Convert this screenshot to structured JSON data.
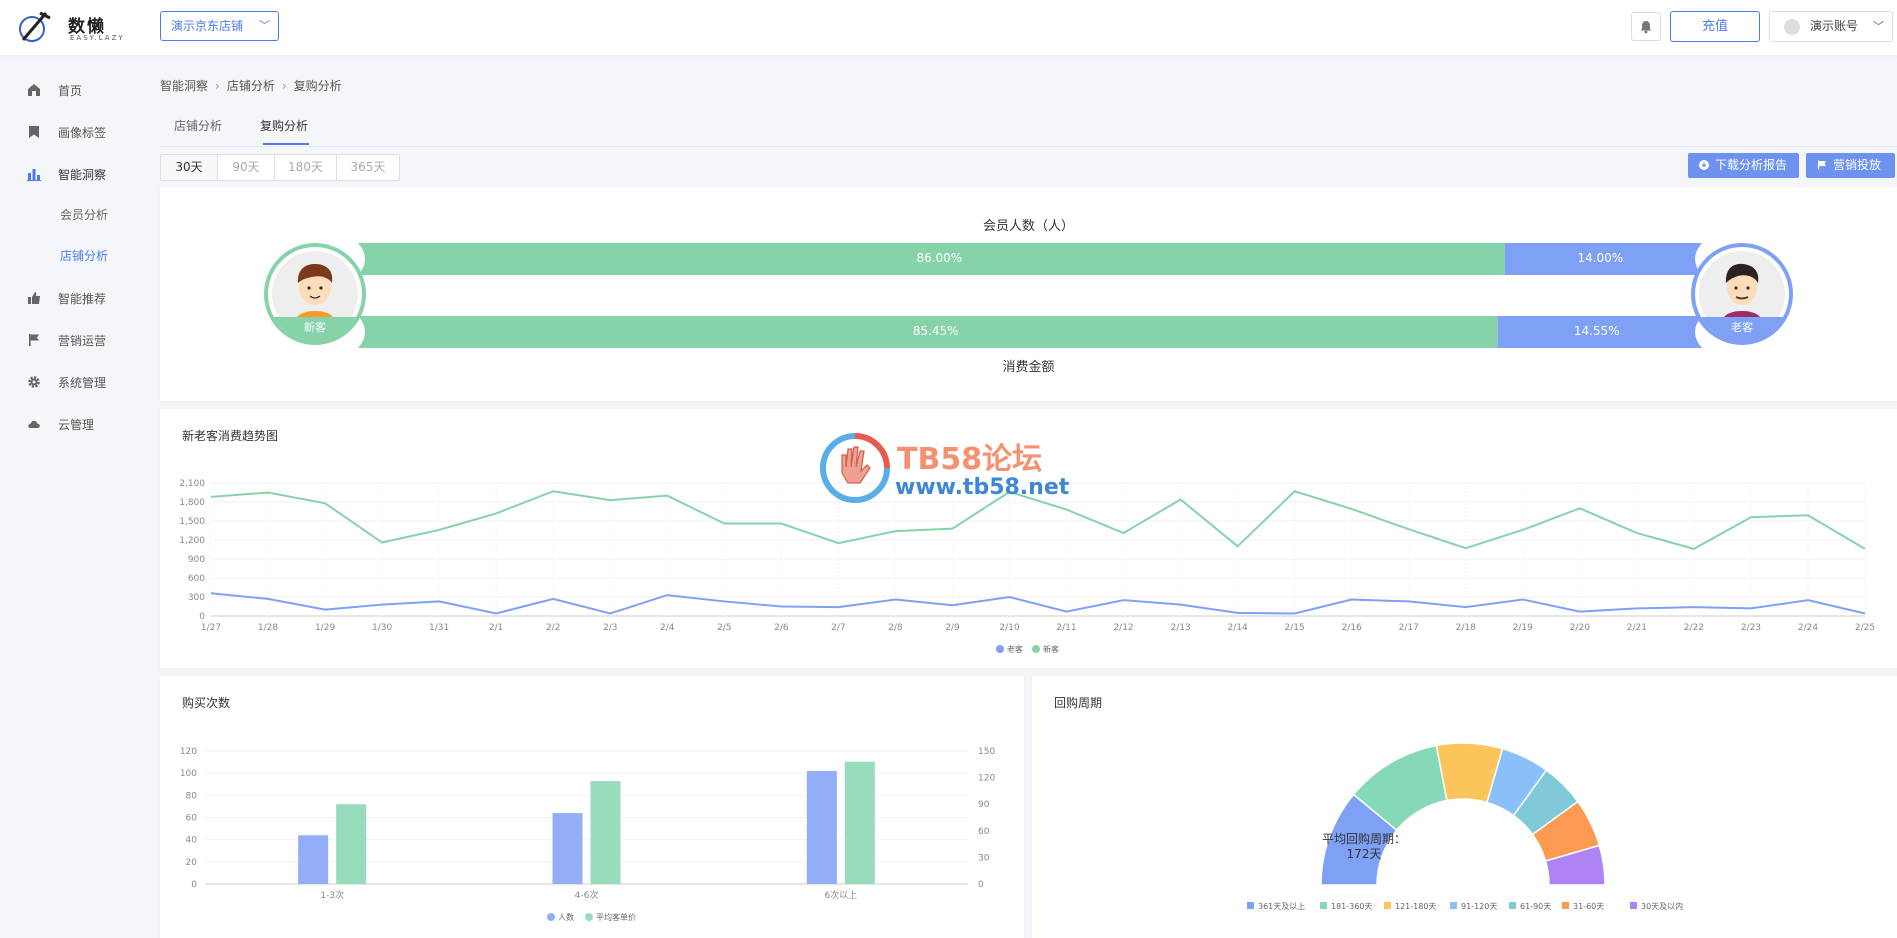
{
  "header": {
    "logo_text": "数懒",
    "logo_sub": "EASY.LAZY",
    "store_select": "演示京东店铺",
    "recharge": "充值",
    "account": "演示账号"
  },
  "sidebar": {
    "items": [
      {
        "label": "首页",
        "icon": "home-icon"
      },
      {
        "label": "画像标签",
        "icon": "bookmark-icon"
      },
      {
        "label": "智能洞察",
        "icon": "bar-chart-icon"
      },
      {
        "label": "智能推荐",
        "icon": "thumbs-up-icon"
      },
      {
        "label": "营销运营",
        "icon": "flag-icon"
      },
      {
        "label": "系统管理",
        "icon": "gear-icon"
      },
      {
        "label": "云管理",
        "icon": "cloud-icon"
      }
    ],
    "sub_items": [
      "会员分析",
      "店铺分析"
    ]
  },
  "breadcrumb": [
    "智能洞察",
    "店铺分析",
    "复购分析"
  ],
  "tabs": [
    "店铺分析",
    "复购分析"
  ],
  "ranges": [
    "30天",
    "90天",
    "180天",
    "365天"
  ],
  "actions": {
    "download": "下载分析报告",
    "marketing": "营销投放"
  },
  "colors": {
    "accent": "#4a7cf0",
    "new": "#86d3aa",
    "old": "#7ea1f5"
  },
  "member_compare": {
    "top_title": "会员人数（人）",
    "bottom_title": "消费金额",
    "new_label": "新客",
    "old_label": "老客",
    "members_new_pct": 86.0,
    "members_old_pct": 14.0,
    "members_new_text": "86.00%",
    "members_old_text": "14.00%",
    "spend_new_pct": 85.45,
    "spend_old_pct": 14.55,
    "spend_new_text": "85.45%",
    "spend_old_text": "14.55%"
  },
  "watermark": {
    "title": "TB58论坛",
    "url": "www.tb58.net"
  },
  "trend_title": "新老客消费趋势图",
  "purchase_title": "购买次数",
  "cycle_title": "回购周期",
  "cycle_center_label": "平均回购周期：",
  "cycle_center_value": "172天",
  "chart_data": [
    {
      "type": "line",
      "title": "新老客消费趋势图",
      "x": [
        "1/27",
        "1/28",
        "1/29",
        "1/30",
        "1/31",
        "2/1",
        "2/2",
        "2/3",
        "2/4",
        "2/5",
        "2/6",
        "2/7",
        "2/8",
        "2/9",
        "2/10",
        "2/11",
        "2/12",
        "2/13",
        "2/14",
        "2/15",
        "2/16",
        "2/17",
        "2/18",
        "2/19",
        "2/20",
        "2/21",
        "2/22",
        "2/23",
        "2/24",
        "2/25"
      ],
      "yticks": [
        0,
        300,
        600,
        900,
        1200,
        1500,
        1800,
        2100
      ],
      "ylim": [
        0,
        2100
      ],
      "legend_position": "bottom",
      "series": [
        {
          "name": "老客",
          "color": "#7ea1f5",
          "values": [
            360,
            270,
            100,
            180,
            230,
            40,
            270,
            40,
            330,
            230,
            150,
            140,
            260,
            170,
            300,
            70,
            250,
            180,
            50,
            40,
            260,
            230,
            140,
            260,
            70,
            120,
            140,
            120,
            250,
            40
          ]
        },
        {
          "name": "新客",
          "color": "#86d3aa",
          "values": [
            1880,
            1950,
            1780,
            1160,
            1360,
            1620,
            1970,
            1830,
            1900,
            1460,
            1460,
            1150,
            1340,
            1380,
            1960,
            1680,
            1310,
            1840,
            1100,
            1970,
            1690,
            1370,
            1070,
            1360,
            1700,
            1310,
            1060,
            1560,
            1590,
            1060
          ]
        }
      ]
    },
    {
      "type": "bar",
      "title": "购买次数",
      "categories": [
        "1-3次",
        "4-6次",
        "6次以上"
      ],
      "ylim_left": [
        0,
        120
      ],
      "yticks_left": [
        0,
        20,
        40,
        60,
        80,
        100,
        120
      ],
      "ylim_right": [
        0,
        150
      ],
      "yticks_right": [
        0,
        30,
        60,
        90,
        120,
        150
      ],
      "legend_position": "bottom",
      "series": [
        {
          "name": "人数",
          "color": "#93aef7",
          "axis": "left",
          "values": [
            44,
            64,
            102
          ]
        },
        {
          "name": "平均客单价",
          "color": "#96dcbd",
          "axis": "right",
          "values": [
            90,
            116,
            138
          ]
        }
      ]
    },
    {
      "type": "pie",
      "title": "回购周期",
      "legend_position": "bottom",
      "slices": [
        {
          "name": "361天及以上",
          "color": "#7ea1f5",
          "value": 22
        },
        {
          "name": "181-360天",
          "color": "#86d9b7",
          "value": 22
        },
        {
          "name": "121-180天",
          "color": "#fcc55b",
          "value": 15
        },
        {
          "name": "91-120天",
          "color": "#8bbff7",
          "value": 11
        },
        {
          "name": "61-90天",
          "color": "#7fc9d8",
          "value": 10
        },
        {
          "name": "31-60天",
          "color": "#fd9a52",
          "value": 11
        },
        {
          "name": "30天及以内",
          "color": "#ae84f5",
          "value": 9
        }
      ]
    }
  ]
}
